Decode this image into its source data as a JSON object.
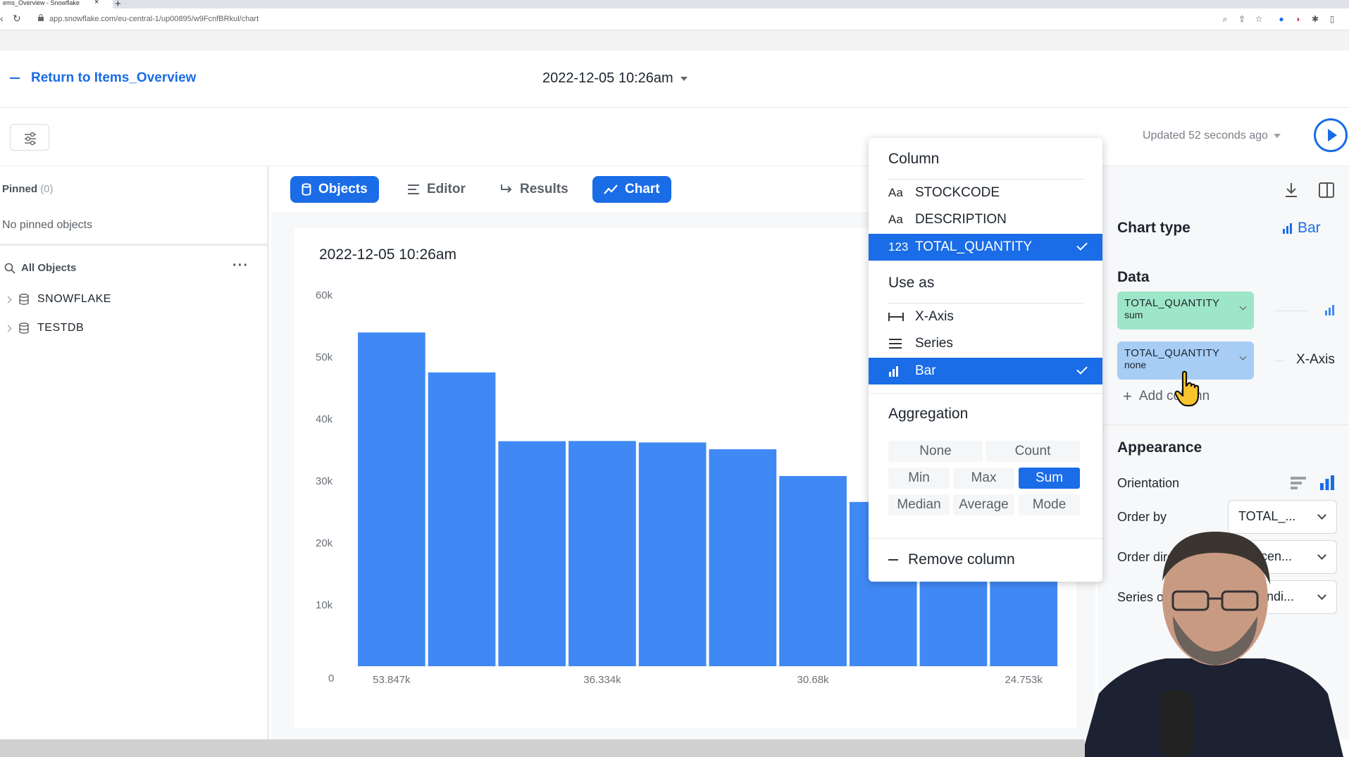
{
  "browser": {
    "tab_title": "ems_Overview - Snowflake",
    "url": "app.snowflake.com/eu-central-1/up00895/w9FcnfBRkul/chart"
  },
  "header": {
    "return_label": "Return to Items_Overview",
    "worksheet_title": "2022-12-05 10:26am",
    "updated_text": "Updated 52 seconds ago"
  },
  "sidebar": {
    "pinned_label": "Pinned",
    "pinned_count": "(0)",
    "no_pinned": "No pinned objects",
    "all_objects_label": "All Objects",
    "databases": [
      {
        "name": "SNOWFLAKE"
      },
      {
        "name": "TESTDB"
      }
    ]
  },
  "tabs": [
    {
      "label": "Objects",
      "active": true
    },
    {
      "label": "Editor",
      "active": false
    },
    {
      "label": "Results",
      "active": false
    },
    {
      "label": "Chart",
      "active": true
    }
  ],
  "chart_data": {
    "type": "bar",
    "title": "2022-12-05 10:26am",
    "xlabel": "",
    "ylabel": "",
    "ylim": [
      0,
      60000
    ],
    "yticks": [
      "0",
      "10k",
      "20k",
      "30k",
      "40k",
      "50k",
      "60k"
    ],
    "ytick_values": [
      0,
      10000,
      20000,
      30000,
      40000,
      50000,
      60000
    ],
    "xtick_labels": [
      {
        "index": 0,
        "label": "53.847k"
      },
      {
        "index": 3,
        "label": "36.334k"
      },
      {
        "index": 6,
        "label": "30.68k"
      },
      {
        "index": 9,
        "label": "24.753k"
      }
    ],
    "values": [
      53847,
      47400,
      36300,
      36334,
      36100,
      35000,
      30680,
      26500,
      25500,
      24753
    ],
    "bar_color": "#4089f5"
  },
  "popover": {
    "column_heading": "Column",
    "columns": [
      {
        "prefix": "Aa",
        "name": "STOCKCODE",
        "selected": false
      },
      {
        "prefix": "Aa",
        "name": "DESCRIPTION",
        "selected": false
      },
      {
        "prefix": "123",
        "name": "TOTAL_QUANTITY",
        "selected": true
      }
    ],
    "use_as_heading": "Use as",
    "use_as": [
      {
        "icon": "x-axis-icon",
        "name": "X-Axis",
        "selected": false
      },
      {
        "icon": "series-icon",
        "name": "Series",
        "selected": false
      },
      {
        "icon": "bar-chart-icon",
        "name": "Bar",
        "selected": true
      }
    ],
    "aggregation_heading": "Aggregation",
    "aggregations": [
      "None",
      "Count",
      "Min",
      "Max",
      "Sum",
      "Median",
      "Average",
      "Mode"
    ],
    "selected_aggregation": "Sum",
    "remove_label": "Remove column"
  },
  "right_panel": {
    "chart_type_label": "Chart type",
    "chart_type_value": "Bar",
    "data_label": "Data",
    "data_columns": [
      {
        "name": "TOTAL_QUANTITY",
        "agg": "sum",
        "color": "#9ee6c9"
      },
      {
        "name": "TOTAL_QUANTITY",
        "agg": "none",
        "color": "#a7cdf5",
        "role": "X-Axis"
      }
    ],
    "add_column_label": "Add column",
    "appearance_label": "Appearance",
    "orientation_label": "Orientation",
    "order_by_label": "Order by",
    "order_by_value": "TOTAL_...",
    "order_dir_label": "Order direction",
    "order_dir_value": "Descen...",
    "series_order_label": "Series order",
    "series_order_value": "Ascendi..."
  },
  "colors": {
    "accent": "#1a6ce7",
    "bar": "#4089f5"
  }
}
